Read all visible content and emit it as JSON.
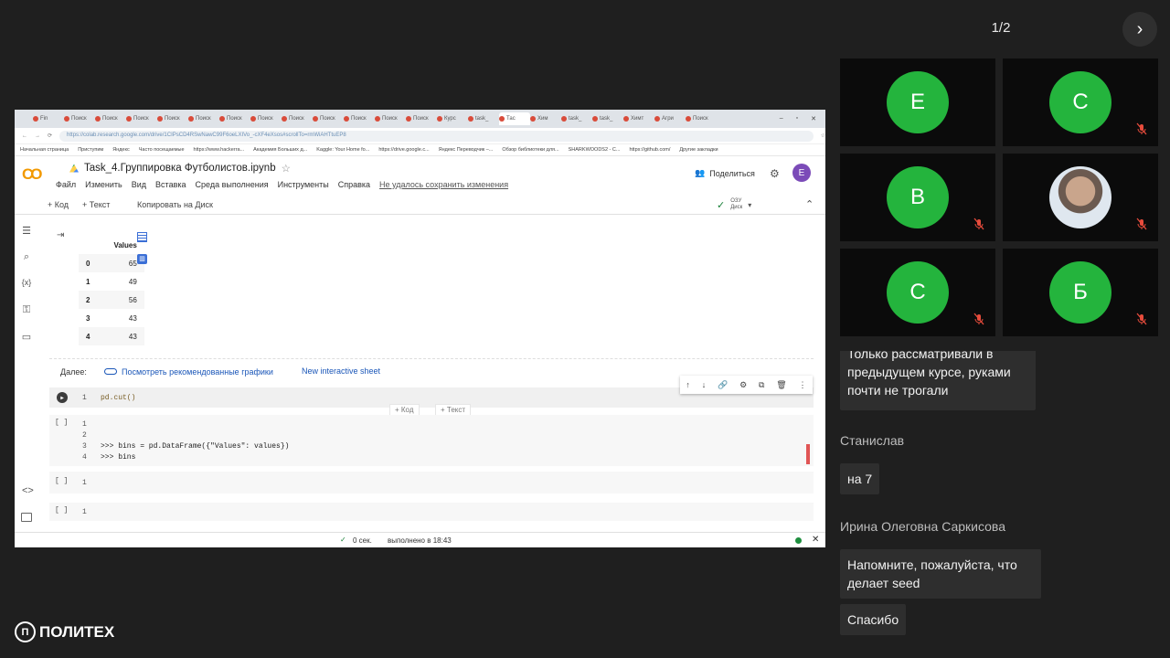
{
  "pager": "1/2",
  "screen": {
    "tabs": [
      "Fin",
      "Поиск",
      "Поиск",
      "Поиск",
      "Поиск",
      "Поиск",
      "Поиск",
      "Поиск",
      "Поиск",
      "Поиск",
      "Поиск",
      "Поиск",
      "Поиск",
      "Курс",
      "task_",
      "Тас",
      "Хим",
      "task_",
      "task_",
      "Химт",
      "Агри",
      "Поиск"
    ],
    "url": "https://colab.research.google.com/drive/1CIPsCD4RSwNawC99F6oeLXIVo_-cXF4eXsos#scrollTo=rmWiAHTtuEP8",
    "bookmarks": [
      "Начальная страница",
      "Приступим",
      "Яндекс",
      "Часто посещаемые",
      "https://www.hackerra...",
      "Академия Больших д...",
      "Kaggle: Your Home fo...",
      "https://drive.google.c...",
      "Яндекс Переводчик –...",
      "Обзор библиотеки для...",
      "SHARKWOODS2 - C...",
      "https://github.com/",
      "Другие закладки"
    ],
    "notebook_title": "Task_4.Группировка Футболистов.ipynb",
    "menu": [
      "Файл",
      "Изменить",
      "Вид",
      "Вставка",
      "Среда выполнения",
      "Инструменты",
      "Справка"
    ],
    "save_warning": "Не удалось сохранить изменения",
    "share": "Поделиться",
    "avatar": "E",
    "toolbar": {
      "code": "+ Код",
      "text": "+ Текст",
      "copy": "Копировать на Диск"
    },
    "ram": "ОЗУ",
    "disk": "Диск",
    "df": {
      "header": "Values",
      "rows": [
        {
          "i": "0",
          "v": "65"
        },
        {
          "i": "1",
          "v": "49"
        },
        {
          "i": "2",
          "v": "56"
        },
        {
          "i": "3",
          "v": "43"
        },
        {
          "i": "4",
          "v": "43"
        }
      ]
    },
    "next_label": "Далее:",
    "reco": "Посмотреть рекомендованные графики",
    "interactive": "New interactive sheet",
    "cell1": {
      "ln": "1",
      "code": "pd.cut()"
    },
    "add_code": "+ Код",
    "add_text": "+ Текст",
    "cell2": {
      "bracket": "[ ]",
      "lines": [
        "1",
        "2",
        "3",
        "4"
      ],
      "code3": ">>> bins = pd.DataFrame({\"Values\": values})",
      "code4": ">>> bins"
    },
    "cell3": {
      "bracket": "[ ]",
      "ln": "1"
    },
    "cell4": {
      "bracket": "[ ]",
      "ln": "1"
    },
    "status": {
      "time": "0 сек.",
      "done": "выполнено в 18:43"
    }
  },
  "participants": [
    {
      "letter": "E",
      "muted": false
    },
    {
      "letter": "C",
      "muted": true
    },
    {
      "letter": "B",
      "muted": true
    },
    {
      "letter": "",
      "muted": true
    },
    {
      "letter": "C",
      "muted": true
    },
    {
      "letter": "Б",
      "muted": true
    }
  ],
  "chat": {
    "msg1": "Только рассматривали в предыдущем курсе, руками почти не трогали",
    "author1": "Станислав",
    "msg2": "на 7",
    "author2": "Ирина Олеговна Саркисова",
    "msg3": "Напомните, пожалуйста, что делает seed",
    "msg4": "Спасибо"
  },
  "brand": "ПОЛИТЕХ",
  "colors": {
    "avatar_green": "#24b43d",
    "colab_orange": "#f29900",
    "link_blue": "#1a56b8"
  }
}
